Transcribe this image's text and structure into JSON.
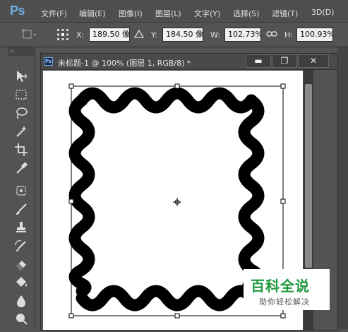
{
  "app": {
    "logo": "Ps",
    "menus": [
      "文件(F)",
      "编辑(E)",
      "图像(I)",
      "图层(L)",
      "文字(Y)",
      "选择(S)",
      "滤镜(T)",
      "3D(D)"
    ]
  },
  "options": {
    "x_label": "X:",
    "x_value": "189.50 像",
    "y_label": "Y:",
    "y_value": "184.50 像",
    "w_label": "W:",
    "w_value": "102.73%",
    "h_label": "H:",
    "h_value": "100.93%",
    "delta_icon": "delta-icon",
    "link_icon": "link-icon"
  },
  "toolbar": {
    "collapse_glyph": "››",
    "tools": [
      "move-tool-icon",
      "marquee-tool-icon",
      "lasso-tool-icon",
      "magic-wand-icon",
      "crop-tool-icon",
      "eyedropper-icon",
      "healing-brush-icon",
      "brush-tool-icon",
      "clone-stamp-icon",
      "history-brush-icon",
      "eraser-icon",
      "paint-bucket-icon",
      "blur-tool-icon",
      "dodge-tool-icon"
    ]
  },
  "document": {
    "title": "未标题-1 @ 100% (图层 1, RGB/8) *",
    "minimize": "▬",
    "restore": "❐",
    "close": "✕"
  },
  "watermark": {
    "main": "百科全说",
    "sub": "助你轻松解决"
  },
  "colors": {
    "accent": "#6fb0e6",
    "watermark_green": "#1f9a3e"
  }
}
